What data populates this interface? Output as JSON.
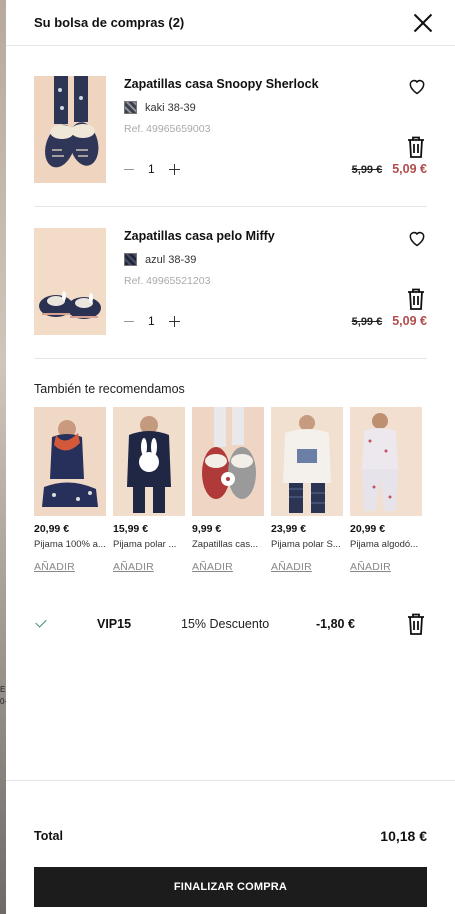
{
  "header": {
    "title": "Su bolsa de compras (2)"
  },
  "items": [
    {
      "name": "Zapatillas casa Snoopy Sherlock",
      "color": "kaki 38-39",
      "swatch": "#3b3f4a",
      "ref": "Ref. 49965659003",
      "qty": "1",
      "old_price": "5,99 €",
      "new_price": "5,09 €"
    },
    {
      "name": "Zapatillas casa pelo Miffy",
      "color": "azul 38-39",
      "swatch": "#22263a",
      "ref": "Ref. 49965521203",
      "qty": "1",
      "old_price": "5,99 €",
      "new_price": "5,09 €"
    }
  ],
  "recommendations": {
    "title": "También te recomendamos",
    "add_label": "AÑADIR",
    "products": [
      {
        "price": "20,99 €",
        "name": "Pijama 100% a..."
      },
      {
        "price": "15,99 €",
        "name": "Pijama polar ..."
      },
      {
        "price": "9,99 €",
        "name": "Zapatillas cas..."
      },
      {
        "price": "23,99 €",
        "name": "Pijama polar S..."
      },
      {
        "price": "20,99 €",
        "name": "Pijama algodó..."
      }
    ]
  },
  "promo": {
    "code": "VIP15",
    "description": "15% Descuento",
    "amount": "-1,80 €"
  },
  "total": {
    "label": "Total",
    "value": "10,18 €"
  },
  "checkout_label": "FINALIZAR COMPRA",
  "colors": {
    "sale": "#b24b4b",
    "check": "#3f8a6b",
    "button": "#1c1c1c"
  },
  "icons": [
    "close-icon",
    "heart-icon",
    "trash-icon",
    "minus-icon",
    "plus-icon",
    "check-icon"
  ],
  "background": {
    "text": "E\n\n0-"
  }
}
